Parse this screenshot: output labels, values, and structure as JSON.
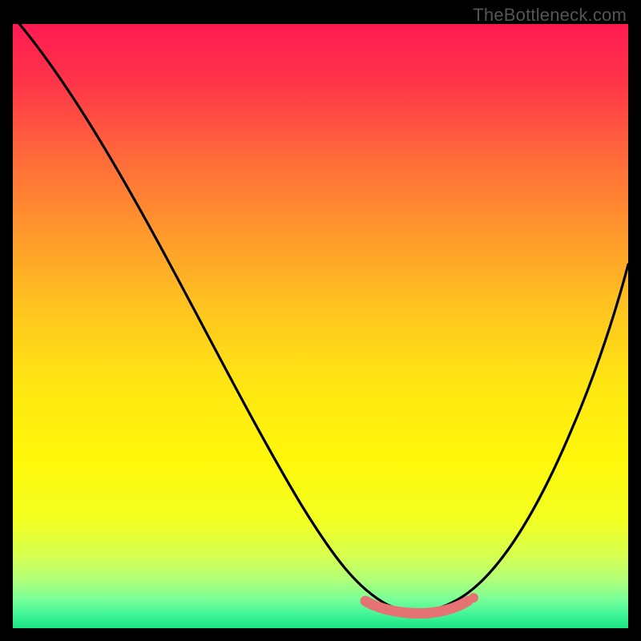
{
  "watermark": "TheBottleneck.com",
  "chart_data": {
    "type": "line",
    "title": "",
    "xlabel": "",
    "ylabel": "",
    "xlim": [
      0,
      100
    ],
    "ylim": [
      0,
      100
    ],
    "grid": false,
    "legend": false,
    "background": "vertical-heat-gradient (red top to green bottom)",
    "series": [
      {
        "name": "bottleneck_curve",
        "x": [
          0,
          5,
          10,
          15,
          20,
          25,
          30,
          35,
          40,
          45,
          50,
          55,
          58,
          61,
          64,
          67,
          70,
          73,
          76,
          80,
          85,
          90,
          95,
          100
        ],
        "y": [
          100,
          95,
          88,
          80,
          72,
          63,
          54,
          45,
          36,
          27,
          19,
          11,
          7,
          4,
          2,
          2,
          3,
          4,
          7,
          12,
          22,
          36,
          50,
          62
        ]
      }
    ],
    "annotations": [
      {
        "name": "optimal_range",
        "style": "thick-salmon-segment",
        "x_range": [
          57,
          74
        ],
        "note": "flat valley near y≈2–4 highlighted"
      },
      {
        "name": "marker",
        "style": "salmon-dot",
        "x": 75,
        "y": 5
      }
    ],
    "gradient_stops": [
      {
        "pos": 0.0,
        "color": "#ff1a52"
      },
      {
        "pos": 0.22,
        "color": "#ff6a3a"
      },
      {
        "pos": 0.48,
        "color": "#ffc71e"
      },
      {
        "pos": 0.72,
        "color": "#fff70a"
      },
      {
        "pos": 0.88,
        "color": "#d6ff50"
      },
      {
        "pos": 0.95,
        "color": "#7dff96"
      },
      {
        "pos": 1.0,
        "color": "#18e583"
      }
    ]
  }
}
